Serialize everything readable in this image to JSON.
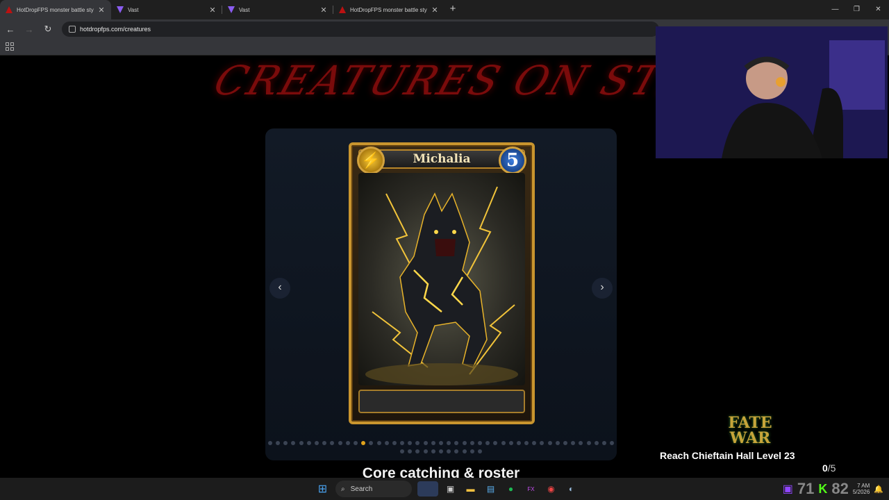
{
  "browser": {
    "tabs": [
      {
        "title": "HotDropFPS monster battle sty",
        "active": true
      },
      {
        "title": "Vast",
        "active": false
      },
      {
        "title": "Vast",
        "active": false
      },
      {
        "title": "HotDropFPS monster battle sty",
        "active": false
      }
    ],
    "url": "hotdropfps.com/creatures"
  },
  "page": {
    "hero_title": "CREATURES ON STREAM",
    "card": {
      "name": "Michalia",
      "energy_icon": "lightning-icon",
      "cost": "5"
    },
    "carousel": {
      "prev_label": "‹",
      "next_label": "›",
      "dot_count": 56,
      "active_index": 12
    },
    "section_title": "Core catching & roster"
  },
  "stream_overlay": {
    "logo_line1": "FATE",
    "logo_line2": "WAR",
    "goal_text": "Reach Chieftain Hall Level 23",
    "goal_progress": "0",
    "goal_total": "/5",
    "stat1": "71",
    "stat2": "82"
  },
  "taskbar": {
    "search_label": "Search",
    "time": "7 AM",
    "date": "5/2026"
  },
  "colors": {
    "hero_red": "#7a0b0b",
    "card_gold": "#c9952e",
    "active_dot": "#e0a21c",
    "panel_bg": "#121a26"
  }
}
